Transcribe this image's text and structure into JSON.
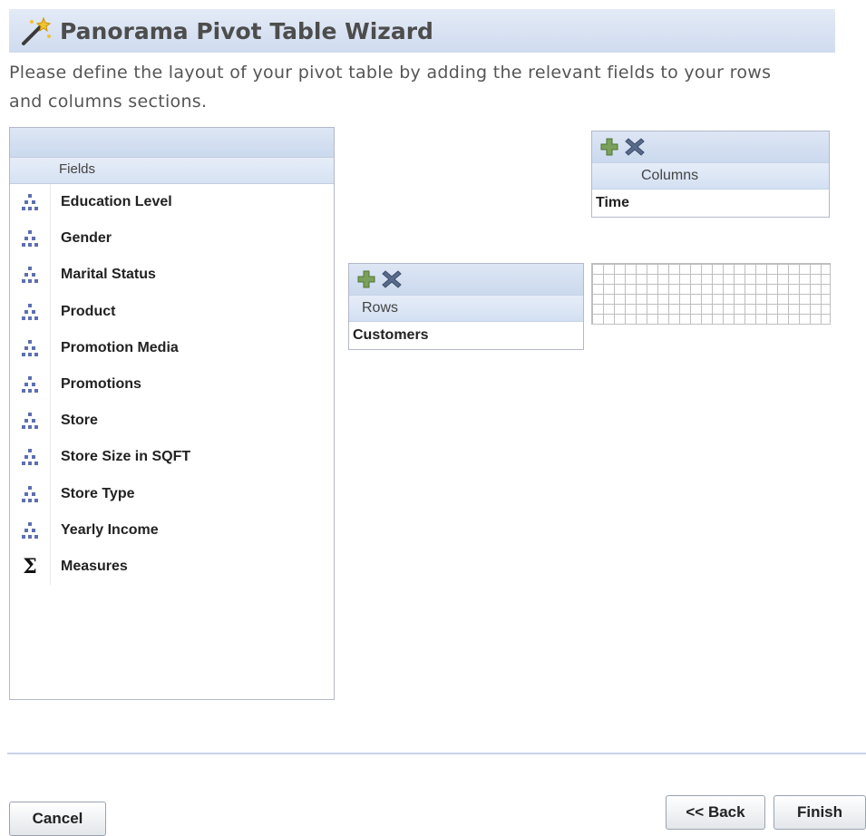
{
  "title": "Panorama Pivot Table Wizard",
  "instructions": "Please define the layout of your pivot table by adding the relevant fields to your rows and columns sections.",
  "fields": {
    "header": "Fields",
    "items": [
      {
        "label": "Education Level",
        "icon": "hierarchy-icon"
      },
      {
        "label": "Gender",
        "icon": "hierarchy-icon"
      },
      {
        "label": "Marital Status",
        "icon": "hierarchy-icon"
      },
      {
        "label": "Product",
        "icon": "hierarchy-icon"
      },
      {
        "label": "Promotion Media",
        "icon": "hierarchy-icon"
      },
      {
        "label": "Promotions",
        "icon": "hierarchy-icon"
      },
      {
        "label": "Store",
        "icon": "hierarchy-icon"
      },
      {
        "label": "Store Size in SQFT",
        "icon": "hierarchy-icon"
      },
      {
        "label": "Store Type",
        "icon": "hierarchy-icon"
      },
      {
        "label": "Yearly Income",
        "icon": "hierarchy-icon"
      },
      {
        "label": "Measures",
        "icon": "sigma-icon"
      }
    ]
  },
  "columns": {
    "header": "Columns",
    "items": [
      "Time"
    ]
  },
  "rows": {
    "header": "Rows",
    "items": [
      "Customers"
    ]
  },
  "buttons": {
    "cancel": "Cancel",
    "back": "<< Back",
    "finish": "Finish"
  },
  "colors": {
    "header_bg": "#cfdbef",
    "add": "#7ba05b",
    "remove": "#596b8c",
    "hierarchy": "#5c6fb0"
  }
}
